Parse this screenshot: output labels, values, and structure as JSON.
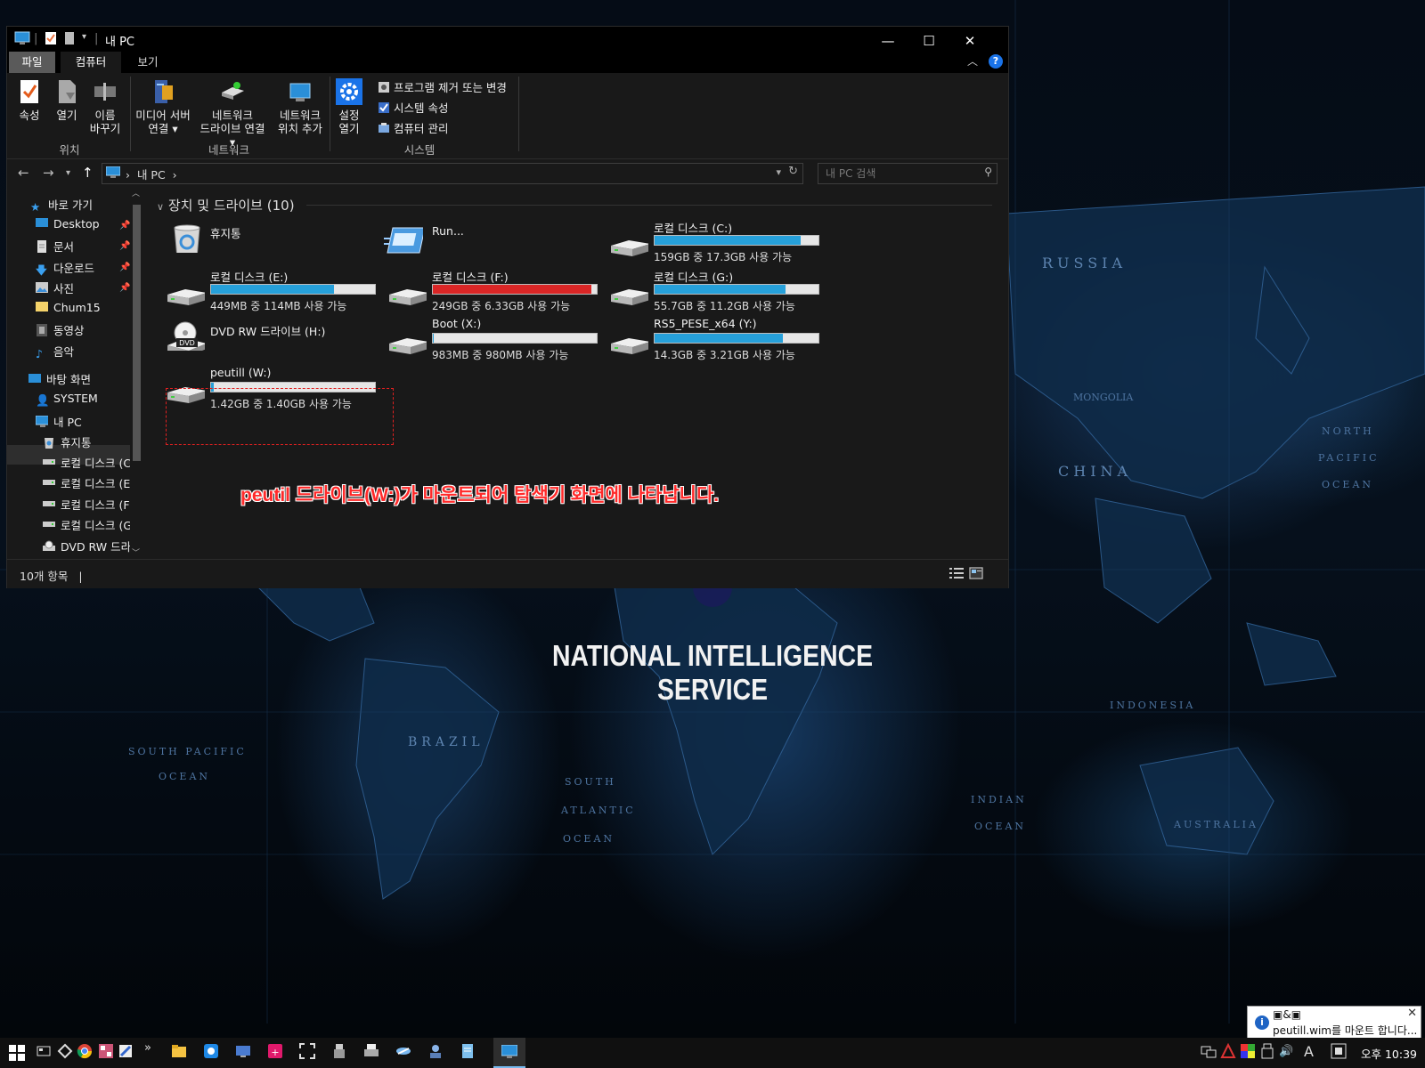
{
  "window": {
    "title": "내 PC",
    "ribbon_tabs": [
      "파일",
      "컴퓨터",
      "보기"
    ]
  },
  "ribbon": {
    "location": {
      "label": "위치",
      "properties": "속성",
      "open": "열기",
      "rename_1": "이름",
      "rename_2": "바꾸기"
    },
    "network": {
      "label": "네트워크",
      "media_1": "미디어 서버",
      "media_2": "연결",
      "map_1": "네트워크",
      "map_2": "드라이브 연결",
      "add_1": "네트워크",
      "add_2": "위치 추가"
    },
    "system": {
      "label": "시스템",
      "settings_1": "설정",
      "settings_2": "열기",
      "uninstall": "프로그램 제거 또는 변경",
      "sys_props": "시스템 속성",
      "manage": "컴퓨터 관리"
    }
  },
  "address": {
    "crumb": "내 PC",
    "search_placeholder": "내 PC 검색"
  },
  "sidebar": {
    "items": [
      {
        "label": "바로 가기",
        "icon": "star-icon"
      },
      {
        "label": "Desktop",
        "icon": "desktop-icon",
        "pinned": true
      },
      {
        "label": "문서",
        "icon": "document-icon",
        "pinned": true
      },
      {
        "label": "다운로드",
        "icon": "download-icon",
        "pinned": true
      },
      {
        "label": "사진",
        "icon": "picture-icon",
        "pinned": true
      },
      {
        "label": "Chum15",
        "icon": "folder-icon"
      },
      {
        "label": "동영상",
        "icon": "video-icon"
      },
      {
        "label": "음악",
        "icon": "music-icon"
      },
      {
        "label": "바탕 화면",
        "icon": "desktop-icon"
      },
      {
        "label": "SYSTEM",
        "icon": "user-icon"
      },
      {
        "label": "내 PC",
        "icon": "pc-icon",
        "selected": true
      },
      {
        "label": "휴지통",
        "icon": "recycle-bin-icon"
      },
      {
        "label": "로컬 디스크 (C",
        "icon": "drive-icon"
      },
      {
        "label": "로컬 디스크 (E",
        "icon": "drive-icon"
      },
      {
        "label": "로컬 디스크 (F",
        "icon": "drive-icon"
      },
      {
        "label": "로컬 디스크 (G",
        "icon": "drive-icon"
      },
      {
        "label": "DVD RW 드라",
        "icon": "dvd-icon"
      }
    ]
  },
  "content": {
    "group_title": "장치 및 드라이브 (10)",
    "items": [
      {
        "name": "휴지통",
        "icon": "recycle-bin-icon"
      },
      {
        "name": "Run...",
        "icon": "run-icon"
      },
      {
        "name": "로컬 디스크 (C:)",
        "free_text": "159GB 중 17.3GB 사용 가능",
        "used_fraction": 0.89,
        "status_color": "#26a0da"
      },
      {
        "name": "로컬 디스크 (E:)",
        "free_text": "449MB 중 114MB 사용 가능",
        "used_fraction": 0.75,
        "status_color": "#26a0da"
      },
      {
        "name": "로컬 디스크 (F:)",
        "free_text": "249GB 중 6.33GB 사용 가능",
        "used_fraction": 0.97,
        "status_color": "#da2626"
      },
      {
        "name": "로컬 디스크 (G:)",
        "free_text": "55.7GB 중 11.2GB 사용 가능",
        "used_fraction": 0.8,
        "status_color": "#26a0da"
      },
      {
        "name": "DVD RW 드라이브 (H:)",
        "icon": "dvd-icon"
      },
      {
        "name": "Boot (X:)",
        "free_text": "983MB 중 980MB 사용 가능",
        "used_fraction": 0.003,
        "status_color": "#26a0da"
      },
      {
        "name": "RS5_PESE_x64 (Y:)",
        "free_text": "14.3GB 중 3.21GB 사용 가능",
        "used_fraction": 0.78,
        "status_color": "#26a0da"
      },
      {
        "name": "peutill (W:)",
        "free_text": "1.42GB 중 1.40GB 사용 가능",
        "used_fraction": 0.014,
        "status_color": "#26a0da"
      }
    ]
  },
  "annotation": "peutil 드라이브(W:)가 마운트되어 탐색기 화면에 나타납니다.",
  "status": {
    "count": "10개 항목",
    "sep": "|"
  },
  "wallpaper": {
    "title": "NATIONAL INTELLIGENCE SERVICE",
    "labels": [
      "RUSSIA",
      "CHINA",
      "MONGOLIA",
      "BRAZIL",
      "INDONESIA",
      "AUSTRALIA",
      "SOUTH PACIFIC",
      "OCEAN",
      "NORTH",
      "PACIFIC",
      "OCEAN",
      "SOUTH",
      "ATLANTIC",
      "OCEAN",
      "INDIAN",
      "OCEAN"
    ]
  },
  "toast": {
    "title": "▣&▣",
    "text": "peutill.wim를 마운트 합니다..."
  },
  "taskbar": {
    "clock": "오후 10:39",
    "ime": "A"
  }
}
